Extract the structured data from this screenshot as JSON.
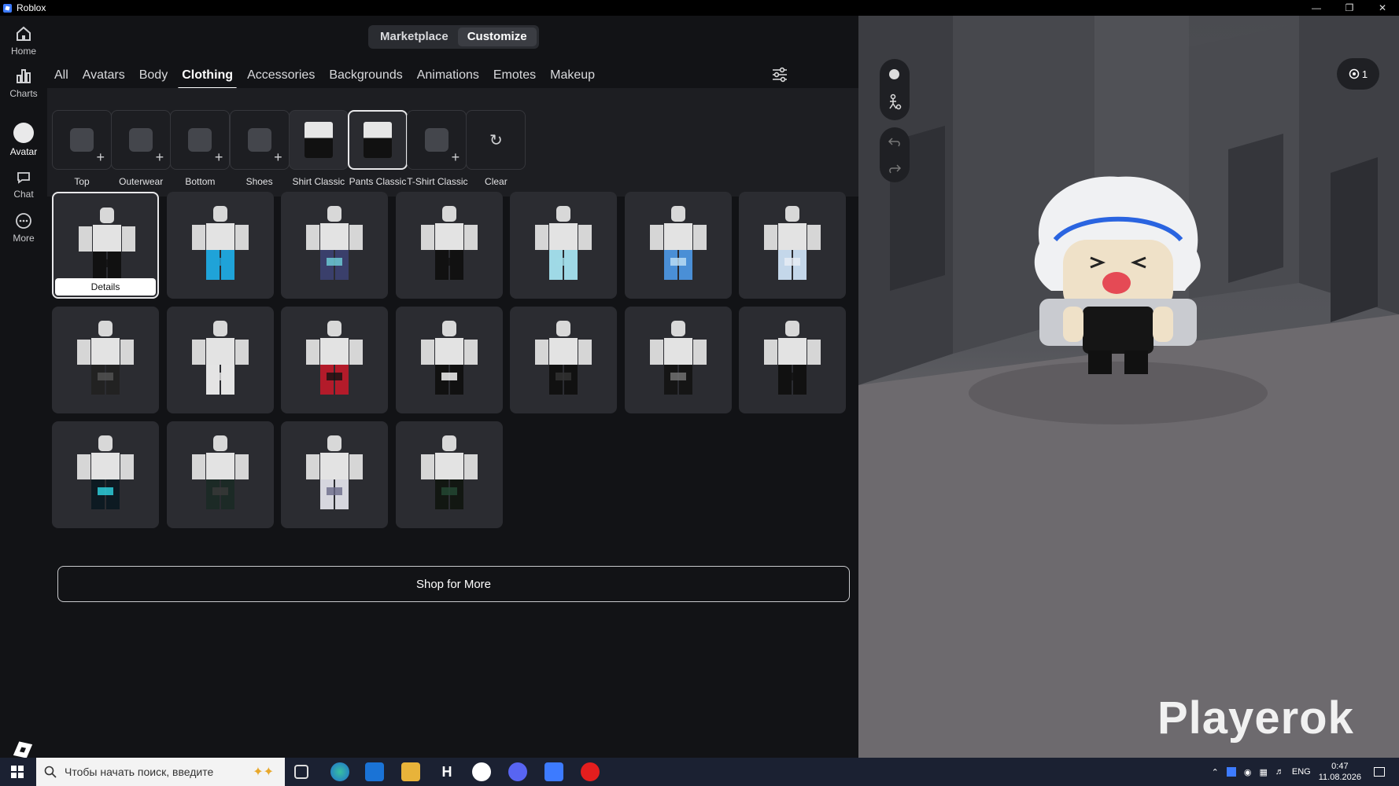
{
  "window": {
    "title": "Roblox"
  },
  "nav": [
    {
      "label": "Home",
      "icon": "home-icon"
    },
    {
      "label": "Charts",
      "icon": "charts-icon"
    },
    {
      "label": "Avatar",
      "icon": "avatar-icon"
    },
    {
      "label": "Chat",
      "icon": "chat-icon"
    },
    {
      "label": "More",
      "icon": "more-icon"
    }
  ],
  "segmented": {
    "marketplace": "Marketplace",
    "customize": "Customize"
  },
  "tabs": [
    "All",
    "Avatars",
    "Body",
    "Clothing",
    "Accessories",
    "Backgrounds",
    "Animations",
    "Emotes",
    "Makeup"
  ],
  "active_tab": "Clothing",
  "slots": [
    {
      "label": "Top",
      "state": "empty"
    },
    {
      "label": "Outerwear",
      "state": "empty"
    },
    {
      "label": "Bottom",
      "state": "empty"
    },
    {
      "label": "Shoes",
      "state": "empty"
    },
    {
      "label": "Shirt Classic",
      "state": "filled"
    },
    {
      "label": "Pants Classic",
      "state": "selected"
    },
    {
      "label": "T-Shirt Classic",
      "state": "empty"
    },
    {
      "label": "Clear",
      "state": "clear"
    }
  ],
  "items": [
    {
      "pants": "#111111",
      "accent": "#111111"
    },
    {
      "pants": "#1fa3d8",
      "accent": "#1fa3d8"
    },
    {
      "pants": "#3a3f6b",
      "accent": "#6fd1d9"
    },
    {
      "pants": "#111111",
      "accent": "#111111"
    },
    {
      "pants": "#9fd9e6",
      "accent": "#9fd9e6"
    },
    {
      "pants": "#4a8fd6",
      "accent": "#bfe0f5"
    },
    {
      "pants": "#c4d7ea",
      "accent": "#e8eef5"
    },
    {
      "pants": "#222222",
      "accent": "#555555"
    },
    {
      "pants": "#e4e4e4",
      "accent": "#e4e4e4"
    },
    {
      "pants": "#b31b2a",
      "accent": "#111111"
    },
    {
      "pants": "#111111",
      "accent": "#ffffff"
    },
    {
      "pants": "#111111",
      "accent": "#333333"
    },
    {
      "pants": "#151515",
      "accent": "#777777"
    },
    {
      "pants": "#111111",
      "accent": "#111111"
    },
    {
      "pants": "#0d1a22",
      "accent": "#2fd7e5"
    },
    {
      "pants": "#1c2a26",
      "accent": "#3a3a3a"
    },
    {
      "pants": "#d6d6de",
      "accent": "#6a6a88"
    },
    {
      "pants": "#121712",
      "accent": "#244a34"
    }
  ],
  "details_label": "Details",
  "shop_more": "Shop for More",
  "viewport": {
    "badge_count": "1",
    "watermark": "Playerok"
  },
  "taskbar": {
    "search_placeholder": "Чтобы начать поиск, введите",
    "lang": "ENG",
    "time": "0:47",
    "date": "11.08.2026"
  },
  "colors": {
    "panel": "#121316",
    "tile": "#2b2c31",
    "taskbar": "#1b2132"
  }
}
